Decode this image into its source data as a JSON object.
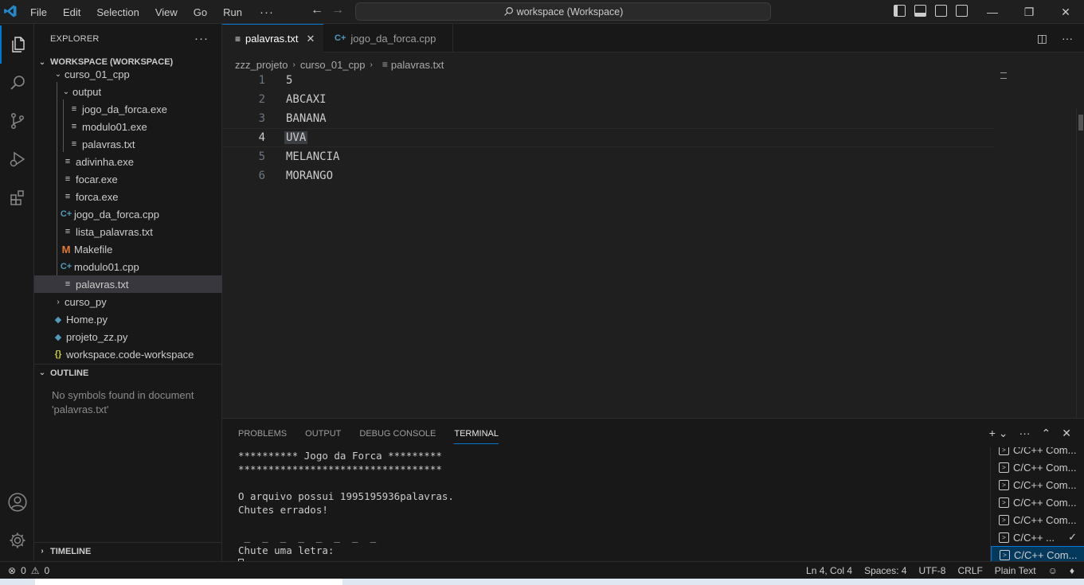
{
  "titlebar": {
    "menu": [
      "File",
      "Edit",
      "Selection",
      "View",
      "Go",
      "Run"
    ],
    "more": "···",
    "search": "workspace (Workspace)"
  },
  "activitybar": {
    "items": [
      "files-icon",
      "search-icon",
      "source-control-icon",
      "run-debug-icon",
      "extensions-icon",
      "account-icon",
      "settings-gear-icon"
    ]
  },
  "sidebar": {
    "title": "EXPLORER",
    "workspace_label": "WORKSPACE (WORKSPACE)",
    "tree": [
      {
        "label": "curso_01_cpp",
        "type": "folder-open"
      },
      {
        "label": "output",
        "type": "folder-open"
      },
      {
        "label": "jogo_da_forca.exe",
        "type": "file"
      },
      {
        "label": "modulo01.exe",
        "type": "file"
      },
      {
        "label": "palavras.txt",
        "type": "file"
      },
      {
        "label": "adivinha.exe",
        "type": "file"
      },
      {
        "label": "focar.exe",
        "type": "file"
      },
      {
        "label": "forca.exe",
        "type": "file"
      },
      {
        "label": "jogo_da_forca.cpp",
        "type": "cpp"
      },
      {
        "label": "lista_palavras.txt",
        "type": "file"
      },
      {
        "label": "Makefile",
        "type": "makefile"
      },
      {
        "label": "modulo01.cpp",
        "type": "cpp"
      },
      {
        "label": "palavras.txt",
        "type": "file",
        "selected": true
      },
      {
        "label": "curso_py",
        "type": "folder-closed"
      },
      {
        "label": "Home.py",
        "type": "python"
      },
      {
        "label": "projeto_zz.py",
        "type": "python"
      },
      {
        "label": "workspace.code-workspace",
        "type": "json"
      }
    ],
    "outline_label": "OUTLINE",
    "outline_message": "No symbols found in document 'palavras.txt'",
    "timeline_label": "TIMELINE"
  },
  "editor": {
    "tabs": [
      {
        "label": "palavras.txt",
        "active": true,
        "close": "✕"
      },
      {
        "label": "jogo_da_forca.cpp",
        "active": false
      }
    ],
    "breadcrumb": [
      "zzz_projeto",
      "curso_01_cpp",
      "palavras.txt"
    ],
    "lines": [
      {
        "n": "1",
        "text": "5"
      },
      {
        "n": "2",
        "text": "ABCAXI"
      },
      {
        "n": "3",
        "text": "BANANA"
      },
      {
        "n": "4",
        "text": "UVA"
      },
      {
        "n": "5",
        "text": "MELANCIA"
      },
      {
        "n": "6",
        "text": "MORANGO"
      }
    ],
    "current_line": 4
  },
  "panel": {
    "tabs": [
      "PROBLEMS",
      "OUTPUT",
      "DEBUG CONSOLE",
      "TERMINAL"
    ],
    "active_tab": "TERMINAL",
    "terminal_lines": [
      "********** Jogo da Forca *********",
      "**********************************",
      "",
      "O arquivo possui 1995195936palavras.",
      "Chutes errados!",
      "",
      " _  _  _  _  _  _  _  _",
      "Chute uma letra:"
    ],
    "terminals": [
      {
        "label": "C/C++ Com..."
      },
      {
        "label": "C/C++ Com..."
      },
      {
        "label": "C/C++ Com..."
      },
      {
        "label": "C/C++ Com..."
      },
      {
        "label": "C/C++ Com..."
      },
      {
        "label": "C/C++ ...",
        "check": true
      },
      {
        "label": "C/C++ Com...",
        "selected": true
      }
    ]
  },
  "statusbar": {
    "errors": "0",
    "warnings": "0",
    "position": "Ln 4, Col 4",
    "spaces": "Spaces: 4",
    "encoding": "UTF-8",
    "eol": "CRLF",
    "language": "Plain Text"
  }
}
